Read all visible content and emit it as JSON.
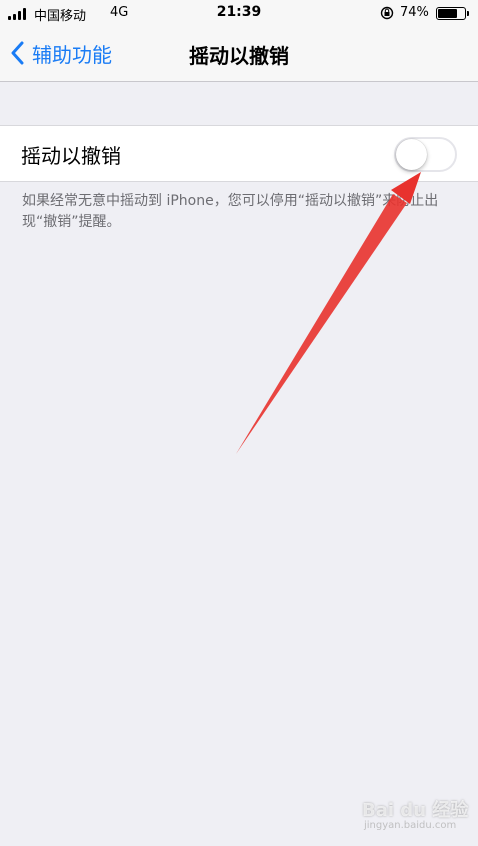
{
  "status_bar": {
    "carrier": "中国移动",
    "network": "4G",
    "time": "21:39",
    "battery_percent": "74%",
    "battery_level": 0.74
  },
  "nav": {
    "back_label": "辅助功能",
    "title": "摇动以撤销"
  },
  "setting": {
    "label": "摇动以撤销",
    "toggle_on": false,
    "description": "如果经常无意中摇动到 iPhone，您可以停用“摇动以撤销”来防止出现“撤销”提醒。"
  },
  "watermark": {
    "brand": "Bai du 经验",
    "url": "jingyan.baidu.com"
  },
  "colors": {
    "accent": "#1a7cf5",
    "arrow": "#e8322e",
    "background": "#efeff4"
  }
}
